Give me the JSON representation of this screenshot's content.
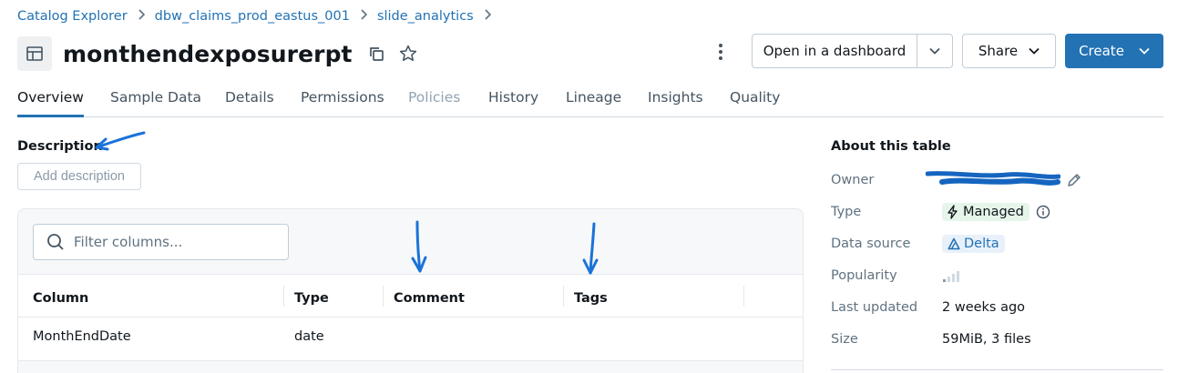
{
  "breadcrumb": {
    "items": [
      "Catalog Explorer",
      "dbw_claims_prod_eastus_001",
      "slide_analytics"
    ]
  },
  "header": {
    "title": "monthendexposurerpt",
    "open_dashboard_label": "Open in a dashboard",
    "share_label": "Share",
    "create_label": "Create"
  },
  "tabs": [
    {
      "label": "Overview",
      "active": true
    },
    {
      "label": "Sample Data"
    },
    {
      "label": "Details"
    },
    {
      "label": "Permissions"
    },
    {
      "label": "Policies",
      "disabled": true
    },
    {
      "label": "History"
    },
    {
      "label": "Lineage"
    },
    {
      "label": "Insights"
    },
    {
      "label": "Quality"
    }
  ],
  "description": {
    "label": "Description",
    "add_label": "Add description"
  },
  "columns_panel": {
    "filter_placeholder": "Filter columns...",
    "headers": [
      "Column",
      "Type",
      "Comment",
      "Tags"
    ],
    "rows": [
      {
        "column": "MonthEndDate",
        "type": "date",
        "comment": "",
        "tags": ""
      }
    ]
  },
  "about": {
    "title": "About this table",
    "owner_label": "Owner",
    "type_label": "Type",
    "type_value": "Managed",
    "data_source_label": "Data source",
    "data_source_value": "Delta",
    "popularity_label": "Popularity",
    "last_updated_label": "Last updated",
    "last_updated_value": "2 weeks ago",
    "size_label": "Size",
    "size_value": "59MiB, 3 files"
  },
  "colors": {
    "accent": "#2272b4",
    "annotation": "#1a73d9",
    "managed_bg": "#e6f5ea",
    "delta_bg": "#e8f1fa"
  }
}
